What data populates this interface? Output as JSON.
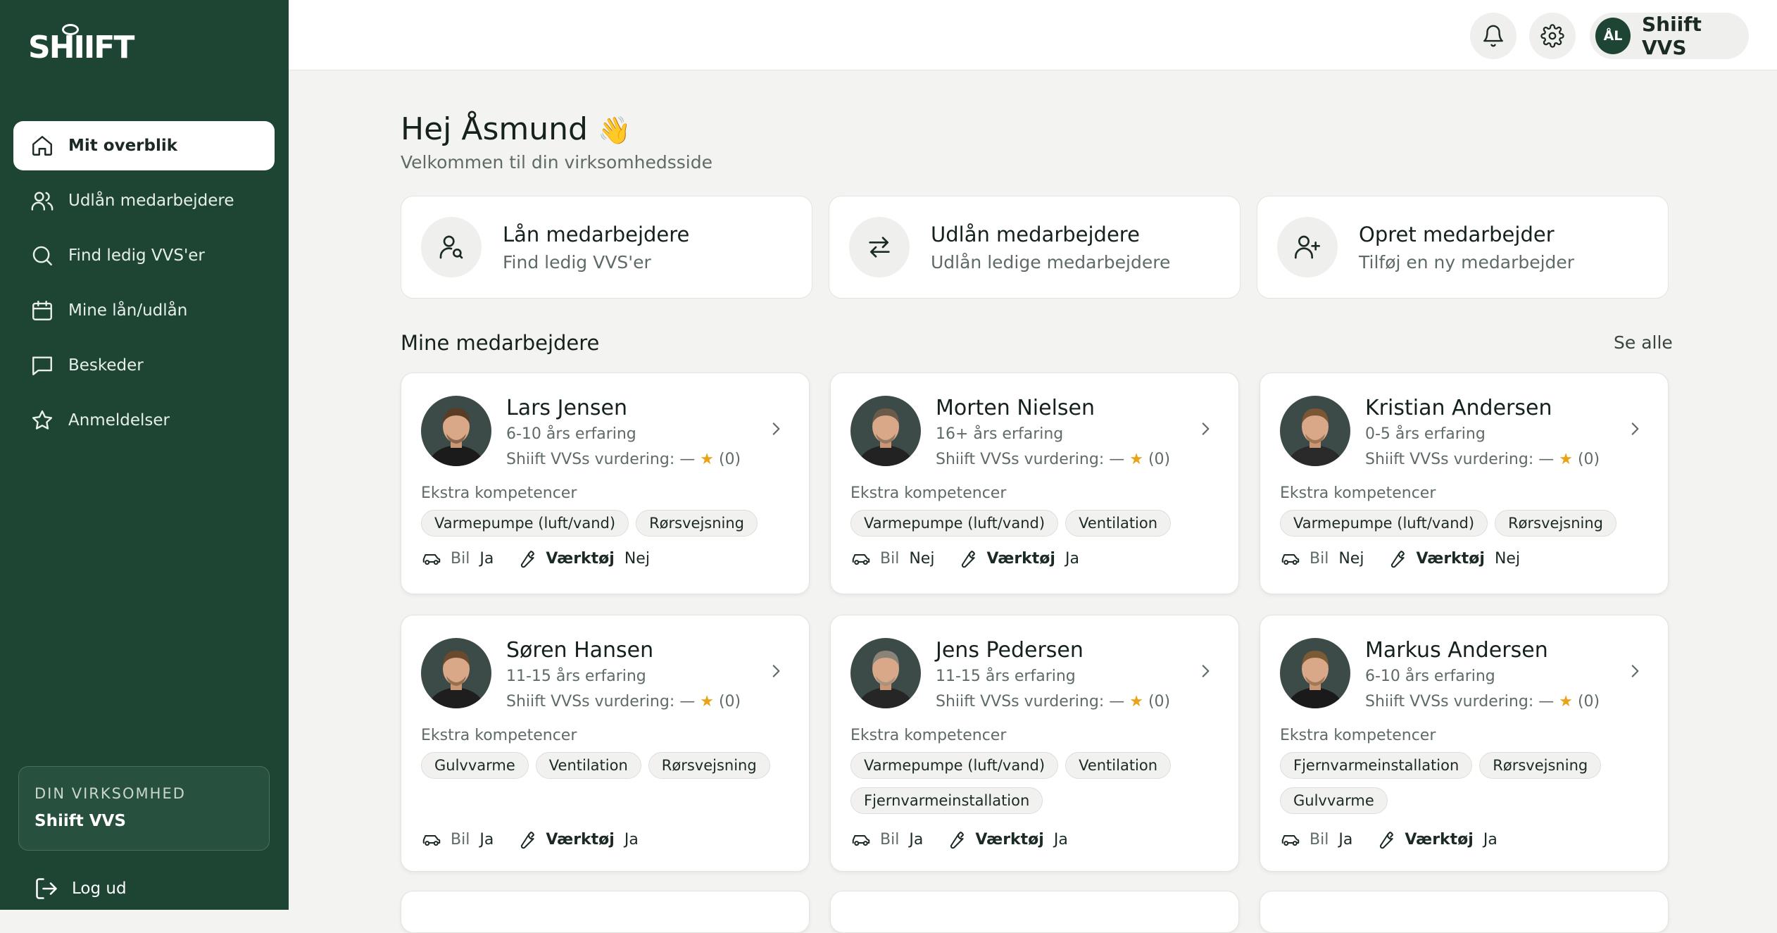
{
  "brand": {
    "logo_text": "SHIIFT"
  },
  "sidebar": {
    "items": [
      {
        "label": "Mit overblik",
        "icon": "home-icon",
        "active": true
      },
      {
        "label": "Udlån medarbejdere",
        "icon": "users-icon"
      },
      {
        "label": "Find ledig VVS'er",
        "icon": "search-icon"
      },
      {
        "label": "Mine lån/udlån",
        "icon": "calendar-icon"
      },
      {
        "label": "Beskeder",
        "icon": "message-icon"
      },
      {
        "label": "Anmeldelser",
        "icon": "star-icon"
      }
    ],
    "company_label": "DIN VIRKSOMHED",
    "company_name": "Shiift VVS",
    "logout_label": "Log ud"
  },
  "topbar": {
    "user_initials": "ÅL",
    "user_name": "Shiift VVS"
  },
  "header": {
    "greeting": "Hej Åsmund",
    "wave": "👋",
    "subtitle": "Velkommen til din virksomhedsside"
  },
  "actions": [
    {
      "title": "Lån medarbejdere",
      "subtitle": "Find ledig VVS'er",
      "icon": "user-search-icon"
    },
    {
      "title": "Udlån medarbejdere",
      "subtitle": "Udlån ledige medarbejdere",
      "icon": "swap-arrows-icon"
    },
    {
      "title": "Opret medarbejder",
      "subtitle": "Tilføj en ny medarbejder",
      "icon": "user-plus-icon"
    }
  ],
  "employees_section": {
    "title": "Mine medarbejdere",
    "see_all": "Se alle",
    "komp_label": "Ekstra kompetencer",
    "rating_prefix": "Shiift VVSs vurdering: —",
    "rating_star": "★",
    "car_label": "Bil",
    "tools_label": "Værktøj"
  },
  "employees": [
    {
      "name": "Lars Jensen",
      "experience": "6-10 års erfaring",
      "rating_count": "(0)",
      "tags": [
        "Varmepumpe (luft/vand)",
        "Rørsvejsning"
      ],
      "car": "Ja",
      "tools": "Nej"
    },
    {
      "name": "Morten Nielsen",
      "experience": "16+ års erfaring",
      "rating_count": "(0)",
      "tags": [
        "Varmepumpe (luft/vand)",
        "Ventilation"
      ],
      "car": "Nej",
      "tools": "Ja"
    },
    {
      "name": "Kristian Andersen",
      "experience": "0-5 års erfaring",
      "rating_count": "(0)",
      "tags": [
        "Varmepumpe (luft/vand)",
        "Rørsvejsning"
      ],
      "car": "Nej",
      "tools": "Nej"
    },
    {
      "name": "Søren Hansen",
      "experience": "11-15 års erfaring",
      "rating_count": "(0)",
      "tags": [
        "Gulvvarme",
        "Ventilation",
        "Rørsvejsning"
      ],
      "car": "Ja",
      "tools": "Ja"
    },
    {
      "name": "Jens Pedersen",
      "experience": "11-15 års erfaring",
      "rating_count": "(0)",
      "tags": [
        "Varmepumpe (luft/vand)",
        "Ventilation",
        "Fjernvarmeinstallation"
      ],
      "car": "Ja",
      "tools": "Ja"
    },
    {
      "name": "Markus Andersen",
      "experience": "6-10 års erfaring",
      "rating_count": "(0)",
      "tags": [
        "Fjernvarmeinstallation",
        "Rørsvejsning",
        "Gulvvarme"
      ],
      "car": "Ja",
      "tools": "Ja"
    }
  ],
  "colors": {
    "sidebar": "#1e4534",
    "accent_star": "#e8a317",
    "background": "#f3f3f1"
  }
}
